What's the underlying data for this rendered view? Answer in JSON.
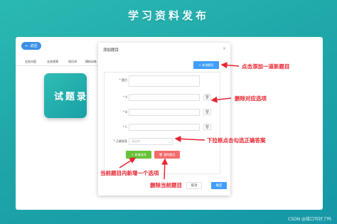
{
  "page_title": "学习资料发布",
  "back_button": {
    "label": "返回",
    "icon": "arrow-left-icon"
  },
  "tabs": [
    "业务内容",
    "业务视频",
    "知识讲",
    "模拟训练"
  ],
  "card_text": "试题录",
  "dialog": {
    "title": "添加题目",
    "close": "×",
    "add_question_button": "新增题目",
    "fields": {
      "question_label": "* 题目",
      "option_a_label": "* A",
      "option_b_label": "* B",
      "option_c_label": "* C",
      "answer_label": "* 正确答案",
      "answer_placeholder": "请选择"
    },
    "add_option_button": "新增选项",
    "delete_question_button": "删除题目",
    "cancel_button": "取消",
    "confirm_button": "确定"
  },
  "annotations": {
    "add_question": "点击添加一道新题目",
    "delete_option": "删除对应选项",
    "select_answer": "下拉框点击勾选正确答案",
    "add_option": "当前题目内新增一个选项",
    "delete_question": "删除当前题目"
  },
  "watermark": "CSDN @接口写好了吗",
  "colors": {
    "accent": "#409eff",
    "success": "#67c23a",
    "danger": "#f56c6c",
    "annotation": "#e8242f"
  }
}
